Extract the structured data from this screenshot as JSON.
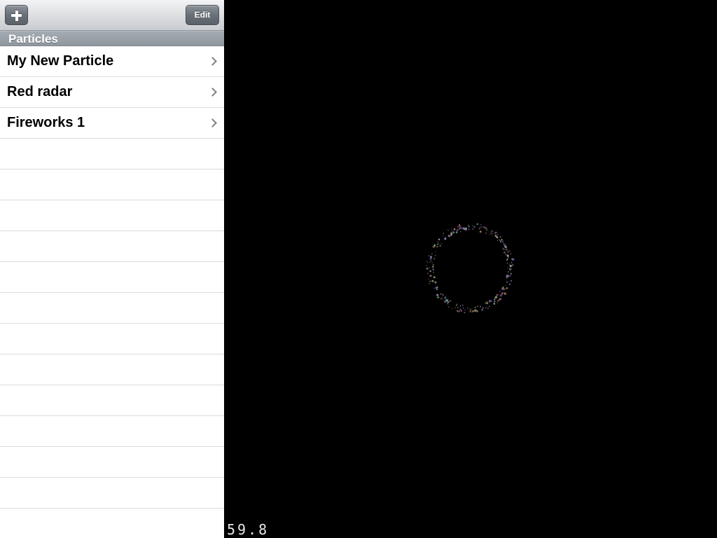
{
  "toolbar": {
    "add_icon": "plus-icon",
    "edit_label": "Edit"
  },
  "section": {
    "title": "Particles"
  },
  "particles": [
    {
      "label": "My New Particle",
      "icon": "chevron-right-icon"
    },
    {
      "label": "Red radar",
      "icon": "chevron-right-icon"
    },
    {
      "label": "Fireworks 1",
      "icon": "chevron-right-icon"
    }
  ],
  "empty_rows": 13,
  "canvas": {
    "background": "#000000",
    "effect": "particle ring",
    "fps": "59.8"
  }
}
